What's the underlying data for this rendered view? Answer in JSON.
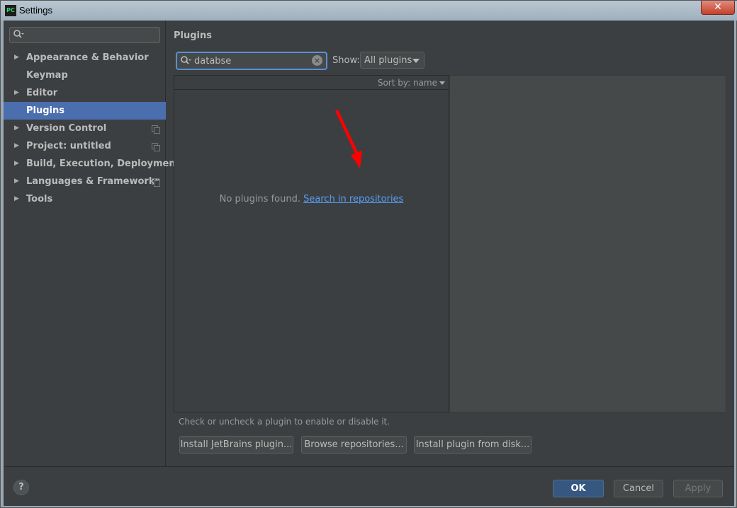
{
  "window": {
    "title": "Settings",
    "app_icon_text": "PC",
    "close_glyph": "✕"
  },
  "sidebar": {
    "search_placeholder": "",
    "items": [
      {
        "label": "Appearance & Behavior",
        "expandable": true,
        "selected": false,
        "project_level": false
      },
      {
        "label": "Keymap",
        "expandable": false,
        "selected": false,
        "project_level": false
      },
      {
        "label": "Editor",
        "expandable": true,
        "selected": false,
        "project_level": false
      },
      {
        "label": "Plugins",
        "expandable": false,
        "selected": true,
        "project_level": false
      },
      {
        "label": "Version Control",
        "expandable": true,
        "selected": false,
        "project_level": true
      },
      {
        "label": "Project: untitled",
        "expandable": true,
        "selected": false,
        "project_level": true
      },
      {
        "label": "Build, Execution, Deployment",
        "expandable": true,
        "selected": false,
        "project_level": false
      },
      {
        "label": "Languages & Frameworks",
        "expandable": true,
        "selected": false,
        "project_level": true
      },
      {
        "label": "Tools",
        "expandable": true,
        "selected": false,
        "project_level": false
      }
    ]
  },
  "plugins": {
    "title": "Plugins",
    "search_value": "databse",
    "show_label": "Show:",
    "show_value": "All plugins",
    "sort_label": "Sort by: name",
    "empty_text": "No plugins found.",
    "empty_link": "Search in repositories",
    "hint": "Check or uncheck a plugin to enable or disable it.",
    "buttons": {
      "install_jetbrains": "Install JetBrains plugin...",
      "browse": "Browse repositories...",
      "install_disk": "Install plugin from disk..."
    }
  },
  "footer": {
    "help": "?",
    "ok": "OK",
    "cancel": "Cancel",
    "apply": "Apply"
  },
  "colors": {
    "accent": "#4b6eaf",
    "link": "#589df6",
    "background": "#3c3f41",
    "annotation_arrow": "#ff0000"
  }
}
